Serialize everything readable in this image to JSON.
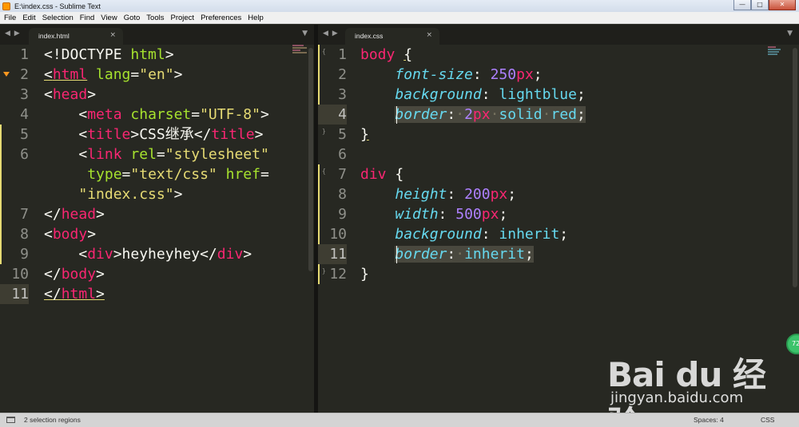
{
  "window": {
    "title": "E:\\index.css - Sublime Text",
    "min": "0",
    "max": "1",
    "close": "r"
  },
  "menu": [
    "File",
    "Edit",
    "Selection",
    "Find",
    "View",
    "Goto",
    "Tools",
    "Project",
    "Preferences",
    "Help"
  ],
  "left_tab": {
    "label": "index.html",
    "close": "×"
  },
  "right_tab": {
    "label": "index.css",
    "close": "×"
  },
  "nav_arrows": "◀ ▶",
  "dropdown_arrow": "▼",
  "left_lines": [
    "1",
    "2",
    "3",
    "4",
    "5",
    "6",
    "7",
    "8",
    "9",
    "10",
    "11"
  ],
  "right_lines": [
    "1",
    "2",
    "3",
    "4",
    "5",
    "6",
    "7",
    "8",
    "9",
    "10",
    "11",
    "12"
  ],
  "html_code": {
    "l1": [
      "<!DOCTYPE ",
      "html",
      ">"
    ],
    "l2": [
      "<",
      "html",
      " ",
      "lang",
      "=",
      "\"en\"",
      ">"
    ],
    "l3": [
      "<",
      "head",
      ">"
    ],
    "l4": [
      "    <",
      "meta",
      " ",
      "charset",
      "=",
      "\"UTF-8\"",
      ">"
    ],
    "l5": [
      "    <",
      "title",
      ">",
      "CSS继承",
      "</",
      "title",
      ">"
    ],
    "l6a": [
      "    <",
      "link",
      " ",
      "rel",
      "=",
      "\"stylesheet\""
    ],
    "l6b": [
      "     ",
      "type",
      "=",
      "\"text/css\"",
      " ",
      "href",
      "="
    ],
    "l6c": [
      "    ",
      "\"index.css\"",
      ">"
    ],
    "l7": [
      "</",
      "head",
      ">"
    ],
    "l8": [
      "<",
      "body",
      ">"
    ],
    "l9": [
      "    <",
      "div",
      ">",
      "heyheyhey",
      "</",
      "div",
      ">"
    ],
    "l10": [
      "</",
      "body",
      ">"
    ],
    "l11": [
      "</",
      "html",
      ">"
    ]
  },
  "css_code": {
    "l1": [
      "body",
      " ",
      "{"
    ],
    "l2": [
      "    ",
      "font-size",
      ": ",
      "250",
      "px",
      ";"
    ],
    "l3": [
      "    ",
      "background",
      ": ",
      "lightblue",
      ";"
    ],
    "l4": [
      "    ",
      "border",
      ":",
      "·",
      "2",
      "px",
      "·",
      "solid",
      "·",
      "red",
      ";"
    ],
    "l5": [
      "}"
    ],
    "l7": [
      "div",
      " ",
      "{"
    ],
    "l8": [
      "    ",
      "height",
      ": ",
      "200",
      "px",
      ";"
    ],
    "l9": [
      "    ",
      "width",
      ": ",
      "500",
      "px",
      ";"
    ],
    "l10": [
      "    ",
      "background",
      ": ",
      "inherit",
      ";"
    ],
    "l11": [
      "    ",
      "border",
      ":",
      "·",
      "inherit",
      ";"
    ],
    "l12": [
      "}"
    ]
  },
  "status": {
    "selection": "2 selection regions",
    "spaces": "Spaces: 4",
    "syntax": "CSS"
  },
  "watermark": {
    "logo": "Bai du 经验",
    "url": "jingyan.baidu.com",
    "badge": "72"
  },
  "colors": {
    "bg": "#272822",
    "tag": "#f92672",
    "attr": "#a6e22e",
    "string": "#e6db74",
    "property": "#66d9ef",
    "number": "#ae81ff"
  }
}
